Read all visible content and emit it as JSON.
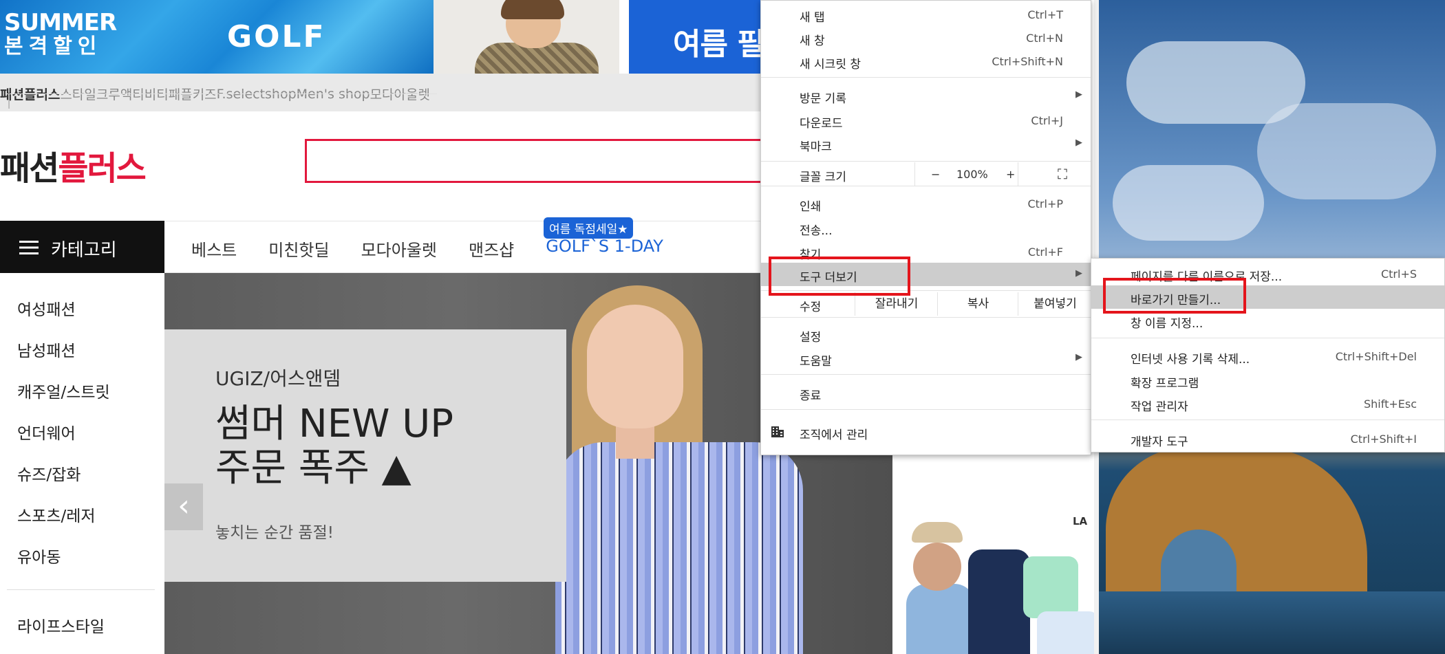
{
  "banner": {
    "summer_line1": "SUMMER",
    "summer_line2": "본격할인",
    "golf": "GOLF",
    "right_text": "여름 필"
  },
  "family_sites": [
    "패션플러스",
    "스타일크루",
    "액티비티",
    "패플키즈",
    "F.selectshop",
    "Men's shop",
    "모다아울렛"
  ],
  "logo": {
    "part1": "패션",
    "part2": "플러스"
  },
  "nav": {
    "category_label": "카테고리",
    "items": [
      "베스트",
      "미친핫딜",
      "모다아울렛",
      "맨즈샵",
      "GOLF`S 1-DAY"
    ],
    "badge": "여름 독점세일★"
  },
  "sidebar": {
    "items": [
      "여성패션",
      "남성패션",
      "캐주얼/스트릿",
      "언더웨어",
      "슈즈/잡화",
      "스포츠/레저",
      "유아동"
    ],
    "extra": "라이프스타일"
  },
  "hero": {
    "brand": "UGIZ/어스앤뎀",
    "headline1": "썸머 NEW UP",
    "headline2": "주문 폭주 ▲",
    "sub": "놓치는 순간 품절!",
    "prev_icon": "‹",
    "side_brand": "LA"
  },
  "menu": {
    "new_tab": {
      "label": "새 탭",
      "shortcut": "Ctrl+T"
    },
    "new_window": {
      "label": "새 창",
      "shortcut": "Ctrl+N"
    },
    "incognito": {
      "label": "새 시크릿 창",
      "shortcut": "Ctrl+Shift+N"
    },
    "history": {
      "label": "방문 기록"
    },
    "downloads": {
      "label": "다운로드",
      "shortcut": "Ctrl+J"
    },
    "bookmarks": {
      "label": "북마크"
    },
    "zoom": {
      "label": "글꼴 크기",
      "minus": "−",
      "value": "100%",
      "plus": "+",
      "fullscreen": "⛶"
    },
    "print": {
      "label": "인쇄",
      "shortcut": "Ctrl+P"
    },
    "cast": {
      "label": "전송..."
    },
    "find": {
      "label": "찾기...",
      "shortcut": "Ctrl+F"
    },
    "more_tools": {
      "label": "도구 더보기"
    },
    "edit": {
      "label": "수정",
      "cut": "잘라내기",
      "copy": "복사",
      "paste": "붙여넣기"
    },
    "settings": {
      "label": "설정"
    },
    "help": {
      "label": "도움말"
    },
    "exit": {
      "label": "종료"
    },
    "managed": {
      "label": "조직에서 관리"
    }
  },
  "submenu": {
    "save_page": {
      "label": "페이지를 다른 이름으로 저장...",
      "shortcut": "Ctrl+S"
    },
    "create_shortcut": {
      "label": "바로가기 만들기..."
    },
    "name_window": {
      "label": "창 이름 지정..."
    },
    "clear_data": {
      "label": "인터넷 사용 기록 삭제...",
      "shortcut": "Ctrl+Shift+Del"
    },
    "extensions": {
      "label": "확장 프로그램"
    },
    "task_manager": {
      "label": "작업 관리자",
      "shortcut": "Shift+Esc"
    },
    "dev_tools": {
      "label": "개발자 도구",
      "shortcut": "Ctrl+Shift+I"
    }
  },
  "colors": {
    "brand_red": "#e2183d",
    "highlight_red": "#e4151c",
    "menu_hover": "#cdcdcd",
    "golf_blue": "#1b63d6"
  },
  "icons": [
    "hamburger-icon",
    "submenu-arrow-icon",
    "fullscreen-icon",
    "building-icon",
    "prev-arrow-icon"
  ]
}
